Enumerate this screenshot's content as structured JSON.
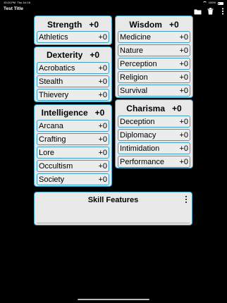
{
  "status_bar": {
    "time": "10:24 PM",
    "date": "Thu Jul 16",
    "battery": "100%"
  },
  "nav": {
    "title": "Test Title"
  },
  "colors": {
    "card_border": "#3b9ec4",
    "card_bg": "#e8e8e8",
    "background": "#000000"
  },
  "icons": {
    "folder": "folder-icon",
    "trash": "trash-icon",
    "more": "more-vertical-icon"
  },
  "strength": {
    "title": "Strength",
    "modifier": "+0",
    "skills": [
      {
        "name": "Athletics",
        "mod": "+0"
      }
    ]
  },
  "dexterity": {
    "title": "Dexterity",
    "modifier": "+0",
    "skills": [
      {
        "name": "Acrobatics",
        "mod": "+0"
      },
      {
        "name": "Stealth",
        "mod": "+0"
      },
      {
        "name": "Thievery",
        "mod": "+0"
      }
    ]
  },
  "intelligence": {
    "title": "Intelligence",
    "modifier": "+0",
    "skills": [
      {
        "name": "Arcana",
        "mod": "+0"
      },
      {
        "name": "Crafting",
        "mod": "+0"
      },
      {
        "name": "Lore",
        "mod": "+0"
      },
      {
        "name": "Occultism",
        "mod": "+0"
      },
      {
        "name": "Society",
        "mod": "+0"
      }
    ]
  },
  "wisdom": {
    "title": "Wisdom",
    "modifier": "+0",
    "skills": [
      {
        "name": "Medicine",
        "mod": "+0"
      },
      {
        "name": "Nature",
        "mod": "+0"
      },
      {
        "name": "Perception",
        "mod": "+0"
      },
      {
        "name": "Religion",
        "mod": "+0"
      },
      {
        "name": "Survival",
        "mod": "+0"
      }
    ]
  },
  "charisma": {
    "title": "Charisma",
    "modifier": "+0",
    "skills": [
      {
        "name": "Deception",
        "mod": "+0"
      },
      {
        "name": "Diplomacy",
        "mod": "+0"
      },
      {
        "name": "Intimidation",
        "mod": "+0"
      },
      {
        "name": "Performance",
        "mod": "+0"
      }
    ]
  },
  "features": {
    "title": "Skill Features"
  }
}
